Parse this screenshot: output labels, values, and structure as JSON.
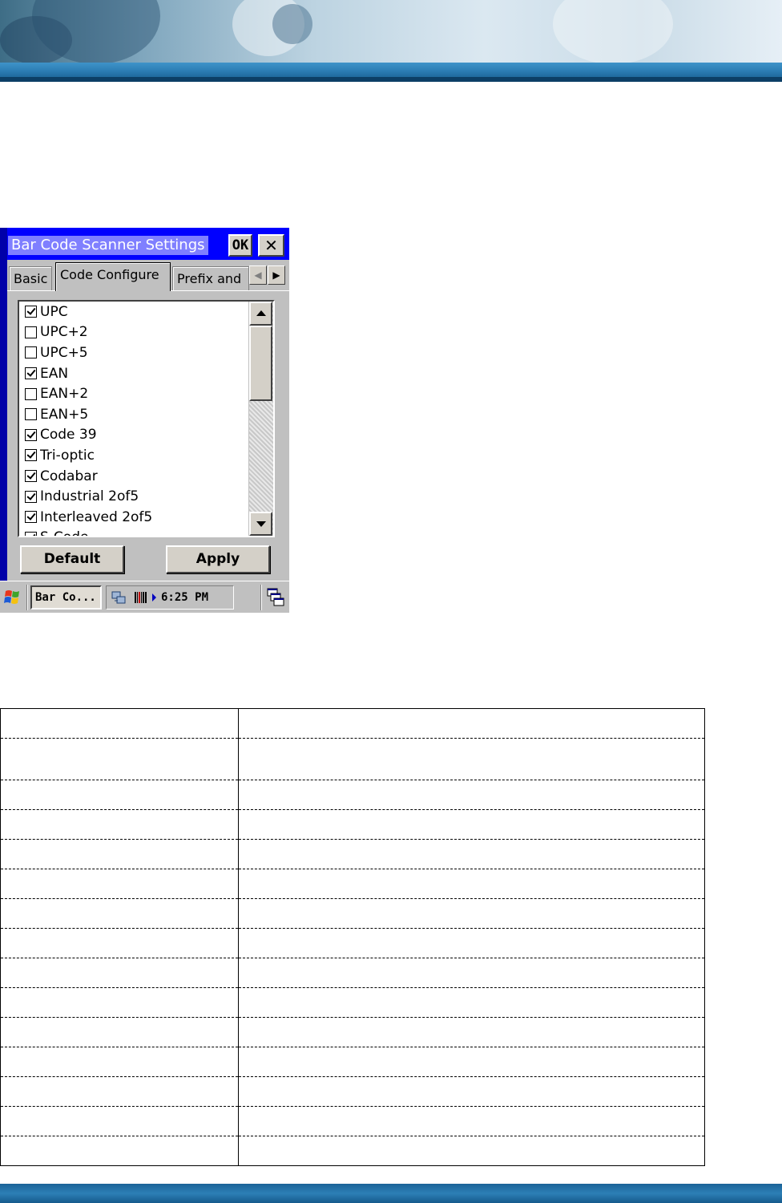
{
  "window": {
    "title": "Bar Code Scanner Settings",
    "ok_label": "OK",
    "close_label": "✕"
  },
  "tabs": [
    {
      "label": "Basic",
      "active": false
    },
    {
      "label": "Code Configure",
      "active": true
    },
    {
      "label": "Prefix and",
      "active": false
    }
  ],
  "tab_scroll": {
    "left": "◀",
    "right": "▶"
  },
  "symbologies": [
    {
      "label": "UPC",
      "checked": true
    },
    {
      "label": "UPC+2",
      "checked": false
    },
    {
      "label": "UPC+5",
      "checked": false
    },
    {
      "label": "EAN",
      "checked": true
    },
    {
      "label": "EAN+2",
      "checked": false
    },
    {
      "label": "EAN+5",
      "checked": false
    },
    {
      "label": "Code 39",
      "checked": true
    },
    {
      "label": "Tri-optic",
      "checked": true
    },
    {
      "label": "Codabar",
      "checked": true
    },
    {
      "label": "Industrial 2of5",
      "checked": true
    },
    {
      "label": "Interleaved 2of5",
      "checked": true
    },
    {
      "label": "S-Code",
      "checked": true
    }
  ],
  "buttons": {
    "default_label": "Default",
    "apply_label": "Apply"
  },
  "taskbar": {
    "task_label": "Bar Co...",
    "clock": "6:25 PM"
  },
  "colors": {
    "title_bar": "#0000ff",
    "window_face": "#c0c0c0",
    "banner_accent": "#2d7fb6"
  },
  "icons": [
    "windows-start-icon",
    "network-icon",
    "barcode-icon",
    "tray-arrow-icon",
    "desktop-icon",
    "chevron-up-icon",
    "chevron-down-icon"
  ]
}
